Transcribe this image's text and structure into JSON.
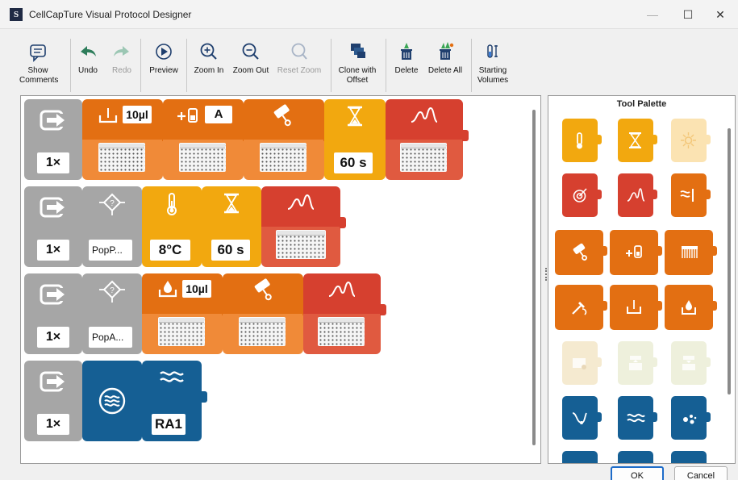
{
  "window": {
    "title": "CellCapTure Visual Protocol Designer",
    "logo_letter": "S",
    "minimize": "—",
    "maximize": "☐",
    "close": "✕"
  },
  "toolbar": {
    "show_comments": "Show Comments",
    "undo": "Undo",
    "redo": "Redo",
    "preview": "Preview",
    "zoom_in": "Zoom In",
    "zoom_out": "Zoom Out",
    "reset_zoom": "Reset Zoom",
    "clone_with_offset": "Clone with Offset",
    "delete": "Delete",
    "delete_all": "Delete All",
    "starting_volumes": "Starting Volumes"
  },
  "protocol": {
    "rows": [
      {
        "repeat": "1×",
        "blocks": [
          {
            "type": "dispense",
            "color": "orange",
            "value": "10µl",
            "icon": "dispense-icon"
          },
          {
            "type": "add-reagent",
            "color": "orange",
            "value": "A",
            "icon": "add-reagent-icon"
          },
          {
            "type": "shake",
            "color": "orange",
            "icon": "shaker-icon"
          },
          {
            "type": "wait",
            "color": "amber",
            "value": "60 s",
            "icon": "hourglass-icon"
          },
          {
            "type": "read",
            "color": "red",
            "icon": "peak-icon"
          }
        ]
      },
      {
        "repeat": "1×",
        "blocks": [
          {
            "type": "condition",
            "color": "gray",
            "value": "PopP...",
            "icon": "condition-icon"
          },
          {
            "type": "temperature",
            "color": "amber",
            "value": "8°C",
            "icon": "thermometer-icon"
          },
          {
            "type": "wait",
            "color": "amber",
            "value": "60 s",
            "icon": "hourglass-icon"
          },
          {
            "type": "read",
            "color": "red",
            "icon": "peak-icon"
          }
        ]
      },
      {
        "repeat": "1×",
        "blocks": [
          {
            "type": "condition",
            "color": "gray",
            "value": "PopA...",
            "icon": "condition-icon"
          },
          {
            "type": "aspirate",
            "color": "orange",
            "value": "10µl",
            "icon": "drop-dispense-icon"
          },
          {
            "type": "shake",
            "color": "orange",
            "icon": "shaker-icon"
          },
          {
            "type": "read",
            "color": "red",
            "icon": "peak-icon"
          }
        ]
      },
      {
        "repeat": "1×",
        "blocks": [
          {
            "type": "analysis",
            "color": "blue",
            "icon": "wave-circle-icon"
          },
          {
            "type": "analysis-result",
            "color": "blue",
            "value": "RA1",
            "icon": "wave-icon"
          }
        ]
      }
    ]
  },
  "palette": {
    "title": "Tool Palette",
    "items": [
      {
        "icon": "thermometer-icon",
        "color": "#f2a80f"
      },
      {
        "icon": "hourglass-icon",
        "color": "#f2a80f"
      },
      {
        "icon": "sun-icon",
        "color": "#fbe3b2"
      },
      {
        "icon": "target-icon",
        "color": "#d6402f"
      },
      {
        "icon": "peak-icon",
        "color": "#d6402f"
      },
      {
        "icon": "filter-icon",
        "color": "#e36f12"
      },
      {
        "icon": "shaker-icon",
        "color": "#e36f12"
      },
      {
        "icon": "add-reagent-icon",
        "color": "#e36f12"
      },
      {
        "icon": "multichannel-icon",
        "color": "#e36f12"
      },
      {
        "icon": "pipette-icon",
        "color": "#e36f12"
      },
      {
        "icon": "dispense-icon",
        "color": "#e36f12"
      },
      {
        "icon": "drop-dispense-icon",
        "color": "#e36f12"
      },
      {
        "icon": "plate-settings-icon",
        "color": "#f5ead0"
      },
      {
        "icon": "plate-up-icon",
        "color": "#eef0dc"
      },
      {
        "icon": "plate-down-icon",
        "color": "#eef0dc"
      },
      {
        "icon": "probe-icon",
        "color": "#155f94"
      },
      {
        "icon": "wave-icon",
        "color": "#155f94"
      },
      {
        "icon": "bubbles-icon",
        "color": "#155f94"
      }
    ]
  },
  "buttons": {
    "ok": "OK",
    "cancel": "Cancel"
  }
}
